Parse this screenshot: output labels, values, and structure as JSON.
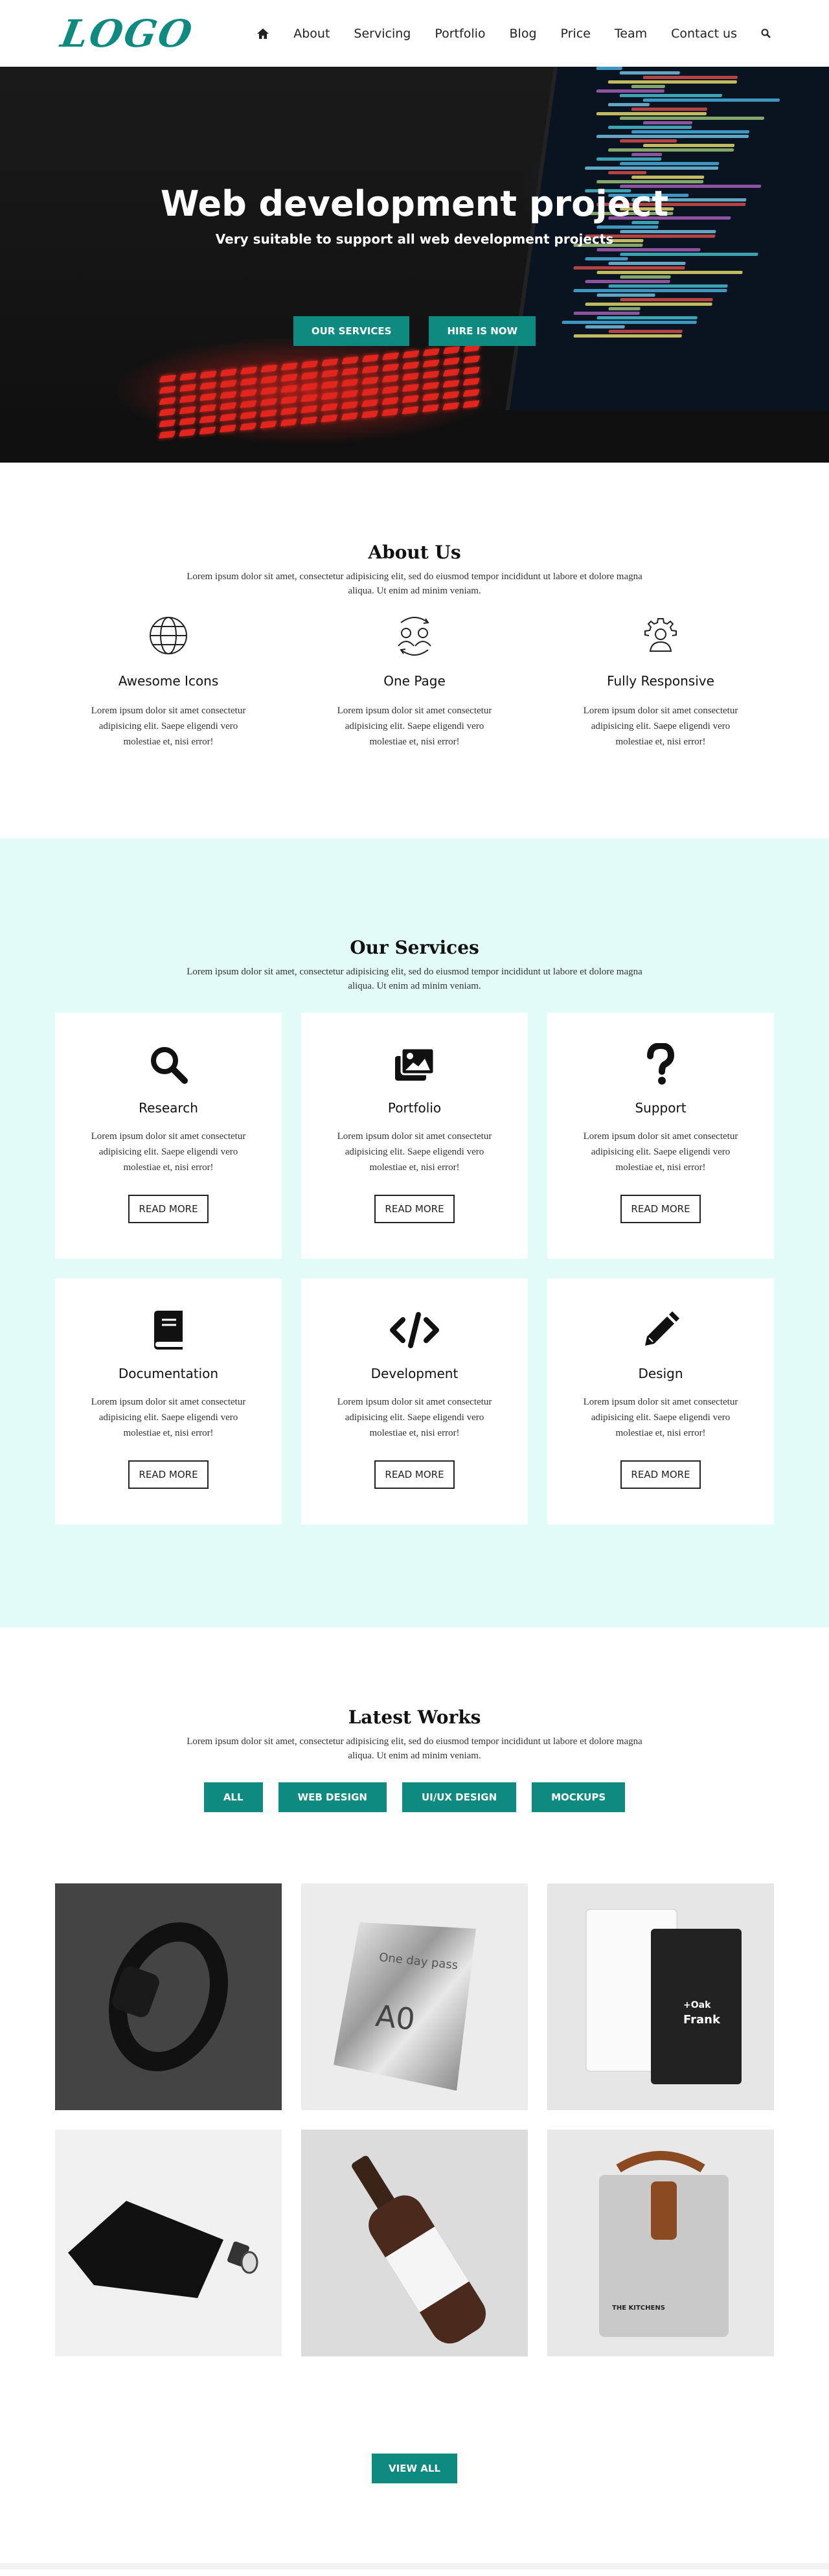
{
  "nav": {
    "logo": "LOGO",
    "items": [
      "About",
      "Servicing",
      "Portfolio",
      "Blog",
      "Price",
      "Team",
      "Contact us"
    ]
  },
  "hero": {
    "title": "Web development project",
    "subtitle": "Very suitable to support all web development projects",
    "btn_services": "OUR SERVICES",
    "btn_hire": "HIRE IS NOW"
  },
  "about": {
    "title": "About Us",
    "desc": "Lorem ipsum dolor sit amet, consectetur adipisicing elit, sed do eiusmod tempor incididunt ut labore et dolore magna aliqua. Ut enim ad minim veniam.",
    "features": [
      {
        "icon": "globe-icon",
        "title": "Awesome Icons",
        "text": "Lorem ipsum dolor sit amet consectetur adipisicing elit. Saepe eligendi vero molestiae et, nisi error!"
      },
      {
        "icon": "users-sync-icon",
        "title": "One Page",
        "text": "Lorem ipsum dolor sit amet consectetur adipisicing elit. Saepe eligendi vero molestiae et, nisi error!"
      },
      {
        "icon": "user-gear-icon",
        "title": "Fully Responsive",
        "text": "Lorem ipsum dolor sit amet consectetur adipisicing elit. Saepe eligendi vero molestiae et, nisi error!"
      }
    ]
  },
  "services": {
    "title": "Our Services",
    "desc": "Lorem ipsum dolor sit amet, consectetur adipisicing elit, sed do eiusmod tempor incididunt ut labore et dolore magna aliqua. Ut enim ad minim veniam.",
    "read_more": "READ MORE",
    "cards": [
      {
        "icon": "search-icon",
        "title": "Research",
        "text": "Lorem ipsum dolor sit amet consectetur adipisicing elit. Saepe eligendi vero molestiae et, nisi error!"
      },
      {
        "icon": "images-icon",
        "title": "Portfolio",
        "text": "Lorem ipsum dolor sit amet consectetur adipisicing elit. Saepe eligendi vero molestiae et, nisi error!"
      },
      {
        "icon": "question-icon",
        "title": "Support",
        "text": "Lorem ipsum dolor sit amet consectetur adipisicing elit. Saepe eligendi vero molestiae et, nisi error!"
      },
      {
        "icon": "book-icon",
        "title": "Documentation",
        "text": "Lorem ipsum dolor sit amet consectetur adipisicing elit. Saepe eligendi vero molestiae et, nisi error!"
      },
      {
        "icon": "code-icon",
        "title": "Development",
        "text": "Lorem ipsum dolor sit amet consectetur adipisicing elit. Saepe eligendi vero molestiae et, nisi error!"
      },
      {
        "icon": "pencil-icon",
        "title": "Design",
        "text": "Lorem ipsum dolor sit amet consectetur adipisicing elit. Saepe eligendi vero molestiae et, nisi error!"
      }
    ]
  },
  "works": {
    "title": "Latest Works",
    "desc": "Lorem ipsum dolor sit amet, consectetur adipisicing elit, sed do eiusmod tempor incididunt ut labore et dolore magna aliqua. Ut enim ad minim veniam.",
    "filters": [
      "ALL",
      "WEB DESIGN",
      "UI/UX DESIGN",
      "MOCKUPS"
    ],
    "items": [
      {
        "name": "watch-mockup-image"
      },
      {
        "name": "foil-pouch-mockup-image",
        "label1": "One day pass",
        "label2": "A0"
      },
      {
        "name": "packaging-bags-mockup-image",
        "label1": "Frank",
        "label2": "+Oak"
      },
      {
        "name": "spout-pouch-mockup-image"
      },
      {
        "name": "wine-bottle-mockup-image"
      },
      {
        "name": "paper-bag-mockup-image",
        "label1": "THE KITCHENS"
      }
    ],
    "view_all": "VIEW ALL"
  },
  "colors": {
    "accent": "#0f8a80",
    "services_bg": "#e2fbf6"
  }
}
